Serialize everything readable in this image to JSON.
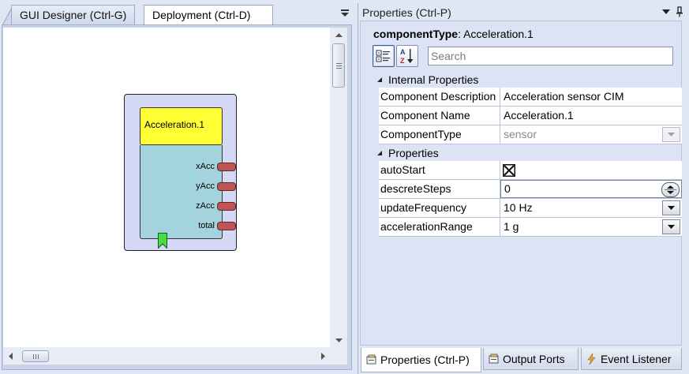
{
  "left_tabs": {
    "gui_designer": "GUI Designer (Ctrl-G)",
    "deployment": "Deployment (Ctrl-D)"
  },
  "component": {
    "title": "Acceleration.1",
    "ports": [
      "xAcc",
      "yAcc",
      "zAcc",
      "total"
    ],
    "colors": {
      "title_bg": "#ffff33",
      "body_bg": "#a3d4de",
      "outer_bg": "#d6d9f6",
      "port": "#c05353",
      "trigger": "#44dd44"
    }
  },
  "properties_panel": {
    "title": "Properties (Ctrl-P)",
    "component_type_label": "componentType",
    "component_type_value": "Acceleration.1",
    "search_placeholder": "Search",
    "categories": [
      {
        "name": "Internal Properties",
        "rows": [
          {
            "name": "Component Description",
            "value": "Acceleration sensor CIM",
            "editor": "text"
          },
          {
            "name": "Component Name",
            "value": "Acceleration.1",
            "editor": "text"
          },
          {
            "name": "ComponentType",
            "value": "sensor",
            "editor": "combo-disabled"
          }
        ]
      },
      {
        "name": "Properties",
        "rows": [
          {
            "name": "autoStart",
            "value": "",
            "editor": "checkbox",
            "checked": true
          },
          {
            "name": "descreteSteps",
            "value": "0",
            "editor": "spinner"
          },
          {
            "name": "updateFrequency",
            "value": "10 Hz",
            "editor": "combo"
          },
          {
            "name": "accelerationRange",
            "value": "1 g",
            "editor": "combo"
          }
        ]
      }
    ]
  },
  "bottom_tabs": [
    {
      "label": "Properties (Ctrl-P)",
      "icon": "properties-icon",
      "active": true
    },
    {
      "label": "Output Ports",
      "icon": "output-ports-icon",
      "active": false
    },
    {
      "label": "Event Listener",
      "icon": "event-listener-icon",
      "active": false
    }
  ]
}
